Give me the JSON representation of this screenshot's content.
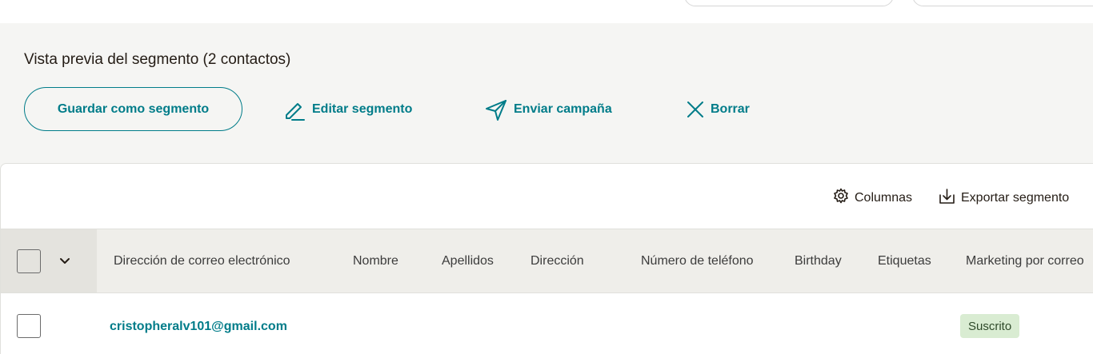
{
  "preview": {
    "title": "Vista previa del segmento (2 contactos)",
    "save_label": "Guardar como segmento",
    "edit_label": "Editar segmento",
    "send_label": "Enviar campaña",
    "clear_label": "Borrar"
  },
  "toolbar": {
    "columns_label": "Columnas",
    "export_label": "Exportar segmento"
  },
  "table": {
    "headers": [
      "Dirección de correo electrónico",
      "Nombre",
      "Apellidos",
      "Dirección",
      "Número de teléfono",
      "Birthday",
      "Etiquetas",
      "Marketing por correo"
    ],
    "rows": [
      {
        "email": "cristopheralv101@gmail.com",
        "marketing_status": "Suscrito"
      }
    ]
  },
  "colors": {
    "accent": "#007c89",
    "status_subscribed_bg": "#d9ecd2"
  }
}
